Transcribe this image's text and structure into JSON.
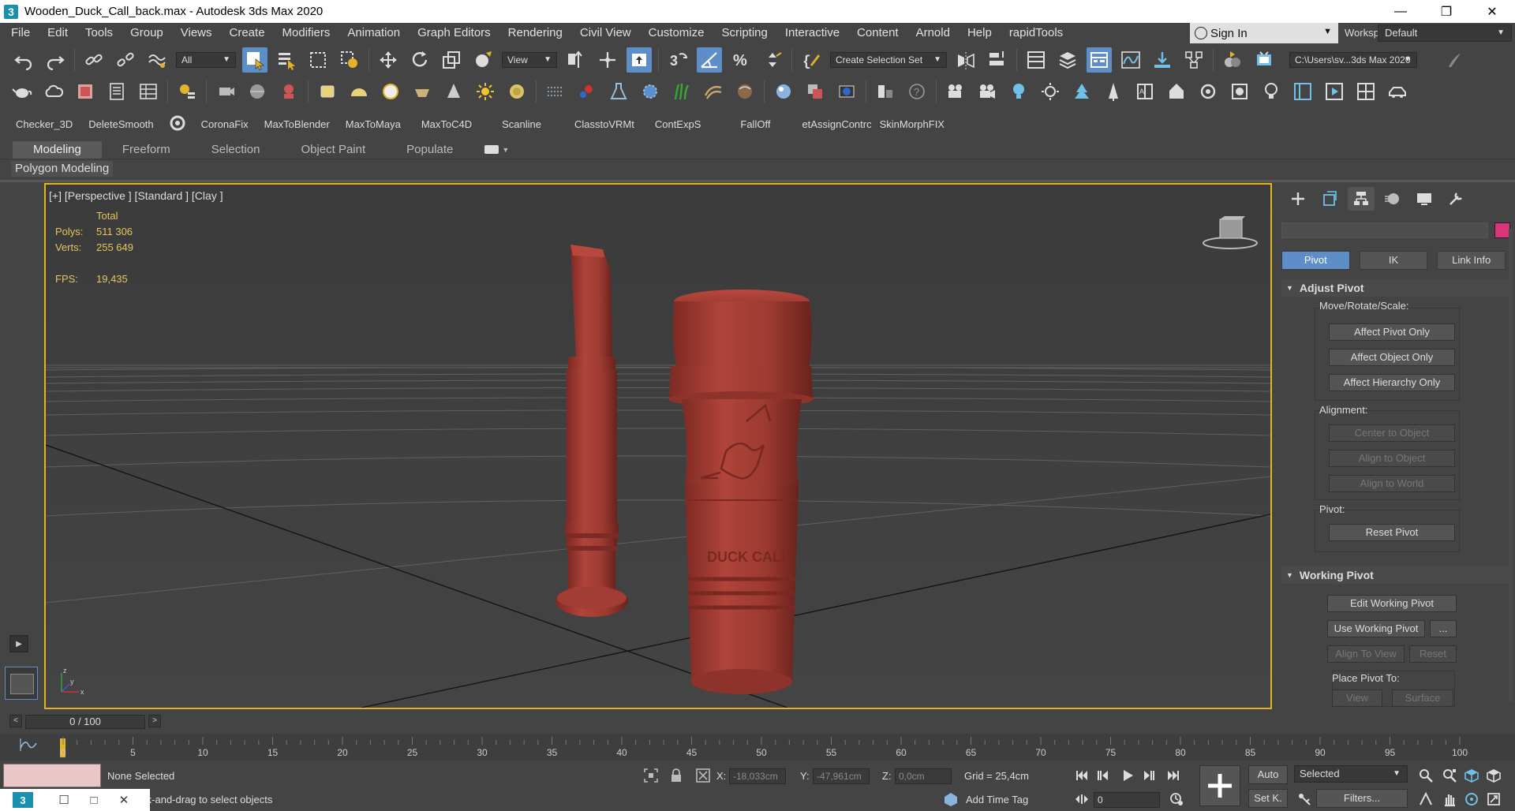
{
  "window": {
    "title": "Wooden_Duck_Call_back.max - Autodesk 3ds Max 2020",
    "minimize": "—",
    "maximize": "❐",
    "close": "✕"
  },
  "menu": [
    "File",
    "Edit",
    "Tools",
    "Group",
    "Views",
    "Create",
    "Modifiers",
    "Animation",
    "Graph Editors",
    "Rendering",
    "Civil View",
    "Customize",
    "Scripting",
    "Interactive",
    "Content",
    "Arnold",
    "Help",
    "rapidTools"
  ],
  "signin": {
    "label": "Sign In"
  },
  "workspaces": {
    "label": "Workspaces:",
    "value": "Default"
  },
  "toolbar": {
    "selection_filter": "All",
    "ref_coord": "View",
    "selection_set": "Create Selection Set",
    "project_path": "C:\\Users\\sv...3ds Max 2020"
  },
  "scripts": [
    "Checker_3D",
    "DeleteSmooth",
    "CoronaFix",
    "MaxToBlender",
    "MaxToMaya",
    "MaxToC4D",
    "Scanline",
    "ClasstoVRMt",
    "ContExpS",
    "FallOff",
    "etAssignContrc",
    "SkinMorphFIX"
  ],
  "ribbon": {
    "tabs": [
      "Modeling",
      "Freeform",
      "Selection",
      "Object Paint",
      "Populate"
    ],
    "active_tab": "Modeling",
    "panel": "Polygon Modeling"
  },
  "viewport": {
    "label": "[+] [Perspective ] [Standard ] [Clay ]",
    "stats": {
      "header": "Total",
      "polys_label": "Polys:",
      "polys": "511 306",
      "verts_label": "Verts:",
      "verts": "255 649",
      "fps_label": "FPS:",
      "fps": "19,435"
    },
    "engraving": "DUCK CALL",
    "axis": {
      "x": "x",
      "y": "y",
      "z": "z"
    },
    "colors": {
      "border": "#e2b32a",
      "clay": "#a53a32",
      "stats": "#e6c55a"
    }
  },
  "command_panel": {
    "hierarchy_tabs": [
      "Pivot",
      "IK",
      "Link Info"
    ],
    "active_hierarchy": "Pivot",
    "adjust_pivot": {
      "title": "Adjust Pivot",
      "move_group": "Move/Rotate/Scale:",
      "affect_pivot": "Affect Pivot Only",
      "affect_object": "Affect Object Only",
      "affect_hierarchy": "Affect Hierarchy Only",
      "alignment_group": "Alignment:",
      "center_to_object": "Center to Object",
      "align_to_object": "Align to Object",
      "align_to_world": "Align to World",
      "pivot_group": "Pivot:",
      "reset_pivot": "Reset Pivot"
    },
    "working_pivot": {
      "title": "Working Pivot",
      "edit": "Edit Working Pivot",
      "use": "Use Working Pivot",
      "more": "...",
      "align_to_view": "Align To View",
      "reset": "Reset",
      "place_label": "Place Pivot To:",
      "view": "View",
      "surface": "Surface"
    },
    "object_color": "#d9357a"
  },
  "timeline": {
    "frame_display": "0 / 100",
    "ticks": [
      "0",
      "5",
      "10",
      "15",
      "20",
      "25",
      "30",
      "35",
      "40",
      "45",
      "50",
      "55",
      "60",
      "65",
      "70",
      "75",
      "80",
      "85",
      "90",
      "95",
      "100"
    ],
    "prev": "<",
    "next": ">"
  },
  "status": {
    "selection": "None Selected",
    "prompt": "Click-and-drag to select objects",
    "x_label": "X:",
    "x_value": "-18,033cm",
    "y_label": "Y:",
    "y_value": "-47,961cm",
    "z_label": "Z:",
    "z_value": "0,0cm",
    "grid": "Grid = 25,4cm",
    "add_time_tag": "Add Time Tag",
    "auto": "Auto",
    "set_key": "Set K.",
    "key_filter_value": "Selected",
    "filters": "Filters...",
    "current_frame": "0"
  }
}
